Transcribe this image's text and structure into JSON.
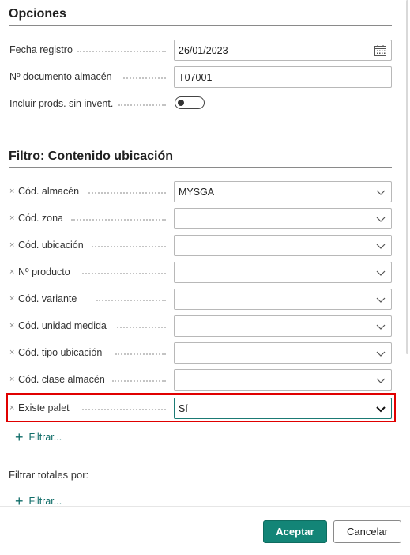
{
  "options": {
    "title": "Opciones",
    "posting_date": {
      "label": "Fecha registro",
      "value": "26/01/2023"
    },
    "whse_document_no": {
      "label": "Nº documento almacén",
      "value": "T07001"
    },
    "include_no_inventory": {
      "label": "Incluir prods. sin invent.",
      "value": false
    }
  },
  "filter": {
    "title": "Filtro: Contenido ubicación",
    "fields": [
      {
        "label": "Cód. almacén",
        "value": "MYSGA"
      },
      {
        "label": "Cód. zona",
        "value": ""
      },
      {
        "label": "Cód. ubicación",
        "value": ""
      },
      {
        "label": "Nº producto",
        "value": ""
      },
      {
        "label": "Cód. variante",
        "value": ""
      },
      {
        "label": "Cód. unidad medida",
        "value": ""
      },
      {
        "label": "Cód. tipo ubicación",
        "value": ""
      },
      {
        "label": "Cód. clase almacén",
        "value": ""
      },
      {
        "label": "Existe palet",
        "value": "Sí"
      }
    ],
    "add_filter_label": "Filtrar..."
  },
  "totals": {
    "title": "Filtrar totales por:",
    "add_filter_label": "Filtrar..."
  },
  "footer": {
    "ok_label": "Aceptar",
    "cancel_label": "Cancelar"
  },
  "colors": {
    "accent": "#138577",
    "highlight": "#e00000",
    "link": "#0f6c68"
  },
  "icons": {
    "remove": "x-icon",
    "dropdown": "chevron-down-icon",
    "calendar": "calendar-icon",
    "add": "plus-icon"
  }
}
